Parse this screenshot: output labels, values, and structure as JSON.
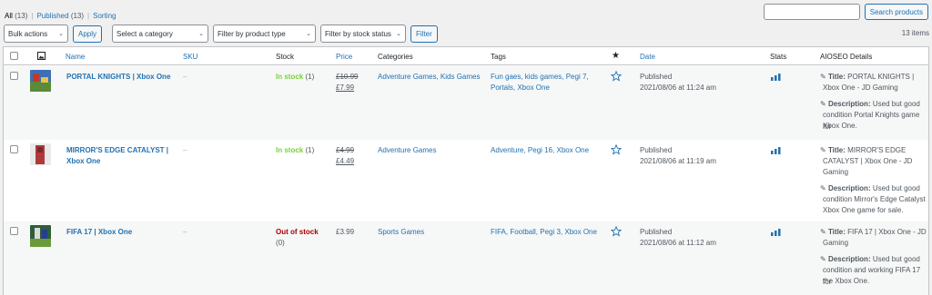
{
  "views": {
    "all": "All",
    "all_count": "(13)",
    "published": "Published",
    "published_count": "(13)",
    "sorting": "Sorting"
  },
  "search": {
    "button": "Search products",
    "value": ""
  },
  "filters": {
    "bulk": "Bulk actions",
    "apply": "Apply",
    "category": "Select a category",
    "product_type": "Filter by product type",
    "stock_status": "Filter by stock status",
    "filter": "Filter"
  },
  "items_count": "13 items",
  "columns": {
    "name": "Name",
    "sku": "SKU",
    "stock": "Stock",
    "price": "Price",
    "categories": "Categories",
    "tags": "Tags",
    "date": "Date",
    "stats": "Stats",
    "aioseo": "AIOSEO Details"
  },
  "labels": {
    "title": "Title:",
    "description": "Description:"
  },
  "colors": {
    "accent": "#2271b1",
    "in_stock": "#7ad03a",
    "out_of_stock": "#a00a00"
  },
  "rows": [
    {
      "name": "PORTAL KNIGHTS | Xbox One",
      "sku": "–",
      "stock": "In stock",
      "stock_qty": "(1)",
      "regular_price": "£10.99",
      "sale_price": "£7.99",
      "categories": "Adventure Games, Kids Games",
      "tags_l1": "Fun gaes, kids games, Pegi 7,",
      "tags_l2": "Portals, Xbox One",
      "status": "Published",
      "date": "2021/08/06 at 11:24 am",
      "title_l1": "PORTAL KNIGHTS |",
      "title_l2": "Xbox One - JD Gaming",
      "desc_l1": "Used but good",
      "desc_l2": "condition Portal Knights game for",
      "desc_l3": "Xbox One."
    },
    {
      "name_l1": "MIRROR'S EDGE CATALYST |",
      "name_l2": "Xbox One",
      "sku": "–",
      "stock": "In stock",
      "stock_qty": "(1)",
      "regular_price": "£4.99",
      "sale_price": "£4.49",
      "categories": "Adventure Games",
      "tags": "Adventure, Pegi 16, Xbox One",
      "status": "Published",
      "date": "2021/08/06 at 11:19 am",
      "title_l1": "MIRROR'S EDGE",
      "title_l2": "CATALYST | Xbox One - JD",
      "title_l3": "Gaming",
      "desc_l1": "Used but good",
      "desc_l2": "condition Mirror's Edge Catalyst",
      "desc_l3": "Xbox One game for sale."
    },
    {
      "name": "FIFA 17 | Xbox One",
      "sku": "–",
      "stock": "Out of stock",
      "stock_qty": "(0)",
      "price": "£3.99",
      "categories": "Sports Games",
      "tags": "FIFA, Football, Pegi 3, Xbox One",
      "status": "Published",
      "date": "2021/08/06 at 11:12 am",
      "title_l1": "FIFA 17 | Xbox One - JD",
      "title_l2": "Gaming",
      "desc_l1": "Used but good",
      "desc_l2": "condition and working FIFA 17 for",
      "desc_l3": "the Xbox One."
    }
  ]
}
